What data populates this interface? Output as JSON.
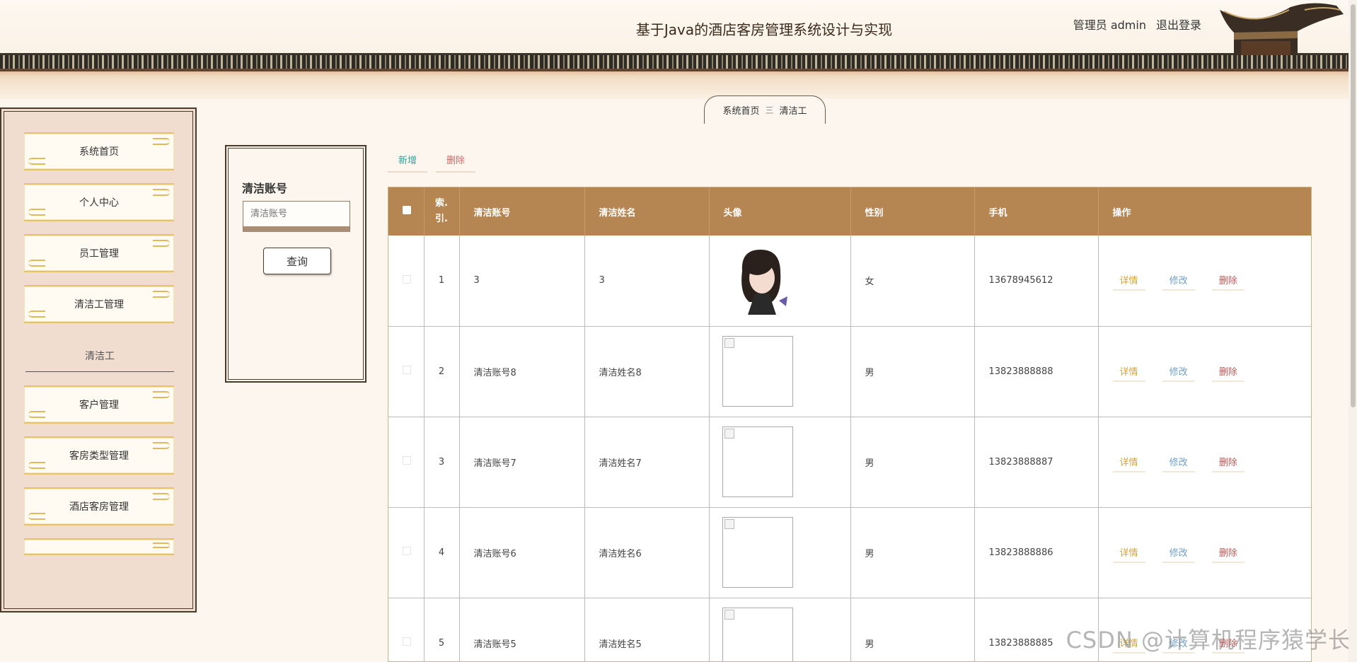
{
  "header": {
    "title": "基于Java的酒店客房管理系统设计与实现",
    "role": "管理员",
    "username": "admin",
    "logout_label": "退出登录"
  },
  "breadcrumb": {
    "home": "系统首页",
    "separator": "三",
    "current": "清洁工"
  },
  "sidebar": {
    "items": [
      {
        "label": "系统首页"
      },
      {
        "label": "个人中心"
      },
      {
        "label": "员工管理"
      },
      {
        "label": "清洁工管理"
      }
    ],
    "sub_item": "清洁工",
    "items_after": [
      {
        "label": "客户管理"
      },
      {
        "label": "客房类型管理"
      },
      {
        "label": "酒店客房管理"
      },
      {
        "label": ""
      }
    ]
  },
  "search": {
    "label": "清洁账号",
    "placeholder": "清洁账号",
    "button_label": "查询"
  },
  "actions": {
    "add_label": "新增",
    "delete_label": "删除"
  },
  "table": {
    "headers": [
      "索引",
      "清洁账号",
      "清洁姓名",
      "头像",
      "性别",
      "手机",
      "操作"
    ],
    "index_header_line1": "索.",
    "index_header_line2": "引.",
    "row_actions": {
      "detail": "详情",
      "edit": "修改",
      "delete": "删除"
    },
    "rows": [
      {
        "index": "1",
        "account": "3",
        "name": "3",
        "avatar": "photo",
        "gender": "女",
        "phone": "13678945612"
      },
      {
        "index": "2",
        "account": "清洁账号8",
        "name": "清洁姓名8",
        "avatar": "broken",
        "gender": "男",
        "phone": "13823888888"
      },
      {
        "index": "3",
        "account": "清洁账号7",
        "name": "清洁姓名7",
        "avatar": "broken",
        "gender": "男",
        "phone": "13823888887"
      },
      {
        "index": "4",
        "account": "清洁账号6",
        "name": "清洁姓名6",
        "avatar": "broken",
        "gender": "男",
        "phone": "13823888886"
      },
      {
        "index": "5",
        "account": "清洁账号5",
        "name": "清洁姓名5",
        "avatar": "broken",
        "gender": "男",
        "phone": "13823888885"
      }
    ]
  },
  "watermark": "CSDN @计算机程序猿学长",
  "colors": {
    "header_bg": "#b58552",
    "accent_add": "#2aa59b",
    "accent_delete": "#d06a6a",
    "detail": "#d6a23a",
    "edit": "#6f9fc9"
  }
}
